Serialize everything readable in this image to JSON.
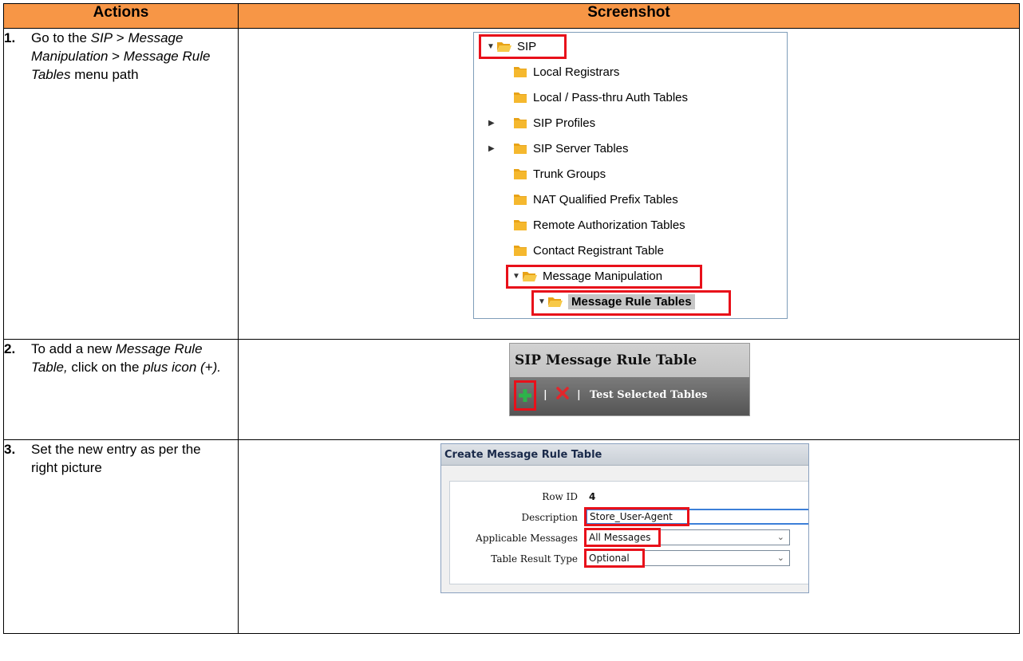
{
  "header": {
    "col_actions": "Actions",
    "col_screenshot": "Screenshot"
  },
  "steps": [
    {
      "num": "1.",
      "parts": [
        "Go to the ",
        "SIP",
        " > ",
        "Message Manipulation",
        " > ",
        "Message Rule Tables",
        " menu path"
      ]
    },
    {
      "num": "2.",
      "parts": [
        "To add a new ",
        "Message Rule Table,",
        " click on the ",
        "plus icon (+)."
      ]
    },
    {
      "num": "3.",
      "parts": [
        "Set the new entry as per the right picture"
      ]
    }
  ],
  "tree": {
    "root": "SIP",
    "items": [
      {
        "label": "Local Registrars",
        "expander": ""
      },
      {
        "label": "Local / Pass-thru Auth Tables",
        "expander": ""
      },
      {
        "label": "SIP Profiles",
        "expander": "collapsed"
      },
      {
        "label": "SIP Server Tables",
        "expander": "collapsed"
      },
      {
        "label": "Trunk Groups",
        "expander": ""
      },
      {
        "label": "NAT Qualified Prefix Tables",
        "expander": ""
      },
      {
        "label": "Remote Authorization Tables",
        "expander": ""
      },
      {
        "label": "Contact Registrant Table",
        "expander": ""
      }
    ],
    "manipulation": "Message Manipulation",
    "rule_tables": "Message Rule Tables"
  },
  "rule_panel": {
    "title": "SIP Message Rule Table",
    "separator": "|",
    "test_label": "Test Selected Tables"
  },
  "form": {
    "title": "Create Message Rule Table",
    "row_id_label": "Row ID",
    "row_id_value": "4",
    "description_label": "Description",
    "description_value": "Store_User-Agent",
    "applicable_label": "Applicable Messages",
    "applicable_value": "All Messages",
    "result_label": "Table Result Type",
    "result_value": "Optional"
  },
  "colors": {
    "header_bg": "#f79646",
    "highlight_red": "#e8101a",
    "plus_green": "#2db34a"
  }
}
